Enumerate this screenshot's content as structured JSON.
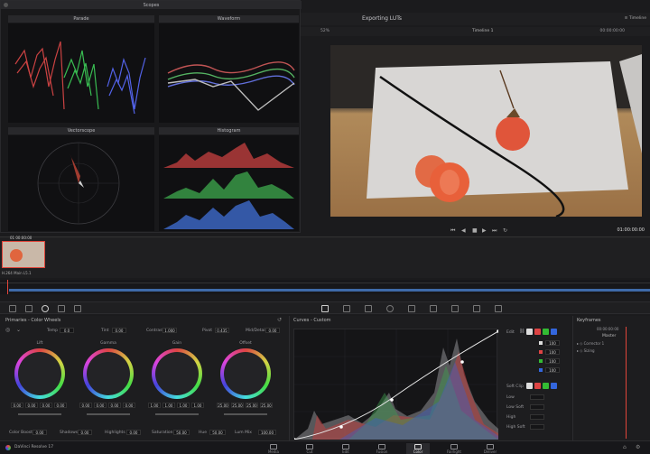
{
  "scopes_window": {
    "title": "Scopes",
    "parade_label": "Parade",
    "waveform_label": "Waveform",
    "vectorscope_label": "Vectorscope",
    "histogram_label": "Histogram"
  },
  "project": {
    "name": "Exporting LUTs",
    "mode_label": "Timeline"
  },
  "viewer": {
    "zoom": "52%",
    "timecode_left": "00:00:00:00",
    "timecode_right": "01:00:00:00",
    "clip_name": "Timeline 1"
  },
  "node_thumb": {
    "label": "01  00:00:00",
    "sub": "H.264 Main L5.1"
  },
  "primaries": {
    "title": "Primaries - Color Wheels",
    "temp_label": "Temp",
    "temp_value": "0.0",
    "tint_label": "Tint",
    "tint_value": "0.00",
    "contrast_label": "Contrast",
    "contrast_value": "1.000",
    "pivot_label": "Pivot",
    "pivot_value": "0.435",
    "md_label": "Mid/Detail",
    "md_value": "0.00",
    "wheels": [
      {
        "name": "Lift",
        "values": [
          "0.00",
          "0.00",
          "0.00",
          "0.00"
        ]
      },
      {
        "name": "Gamma",
        "values": [
          "0.00",
          "0.00",
          "0.00",
          "0.00"
        ]
      },
      {
        "name": "Gain",
        "values": [
          "1.00",
          "1.00",
          "1.00",
          "1.00"
        ]
      },
      {
        "name": "Offset",
        "values": [
          "25.00",
          "25.00",
          "25.00",
          "25.00"
        ]
      }
    ],
    "bottom": [
      {
        "label": "Color Boost",
        "value": "0.00"
      },
      {
        "label": "Shadows",
        "value": "0.00"
      },
      {
        "label": "Highlights",
        "value": "0.00"
      },
      {
        "label": "Saturation",
        "value": "50.00"
      },
      {
        "label": "Hue",
        "value": "50.00"
      },
      {
        "label": "Lum Mix",
        "value": "100.00"
      }
    ]
  },
  "curves": {
    "title": "Curves - Custom",
    "edit_label": "Edit",
    "softclip_label": "Soft Clip",
    "channel_values": [
      "100",
      "100",
      "100",
      "100"
    ],
    "softclip_rows": [
      "Low",
      "Low Soft",
      "High",
      "High Soft"
    ]
  },
  "keyframes": {
    "title": "Keyframes",
    "timecode": "00:00:00:00",
    "master_label": "Master",
    "rows": [
      "Corrector 1",
      "Sizing"
    ]
  },
  "footer": {
    "app_name": "DaVinci Resolve 17"
  },
  "pages": [
    "Media",
    "Cut",
    "Edit",
    "Fusion",
    "Color",
    "Fairlight",
    "Deliver"
  ],
  "colors": {
    "accent_red": "#e0453a",
    "accent_orange": "#e8832b",
    "curve_white": "#e8e8e8",
    "panel_bg": "#1b1b1d"
  }
}
